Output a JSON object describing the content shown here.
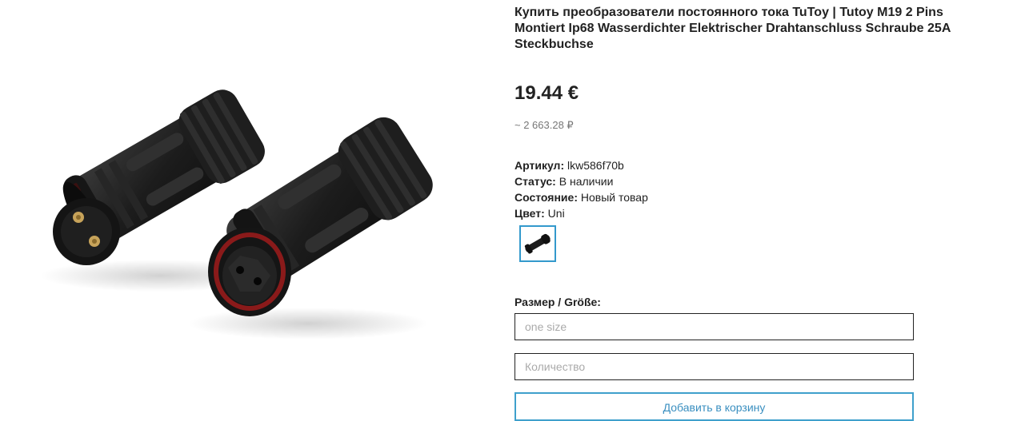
{
  "product": {
    "title": "Купить преобразователи постоянного тока TuToy | Tutoy M19 2 Pins Montiert Ip68 Wasserdichter Elektrischer Drahtanschluss Schraube 25A Steckbuchse",
    "price": "19.44 €",
    "price_alt": "~ 2 663.28 ₽",
    "image_alt": "connector-product-image"
  },
  "props": {
    "sku_label": "Артикул:",
    "sku_value": " lkw586f70b",
    "status_label": "Статус:",
    "status_value": " В наличии",
    "condition_label": "Состояние:",
    "condition_value": " Новый товар",
    "color_label": "Цвет:",
    "color_value": " Uni"
  },
  "form": {
    "size_label": "Размер / Größe:",
    "size_placeholder": "one size",
    "qty_placeholder": "Количество",
    "add_button": "Добавить в корзину"
  },
  "colors": {
    "accent": "#3fa0cc",
    "text": "#222222",
    "muted": "#777777"
  }
}
